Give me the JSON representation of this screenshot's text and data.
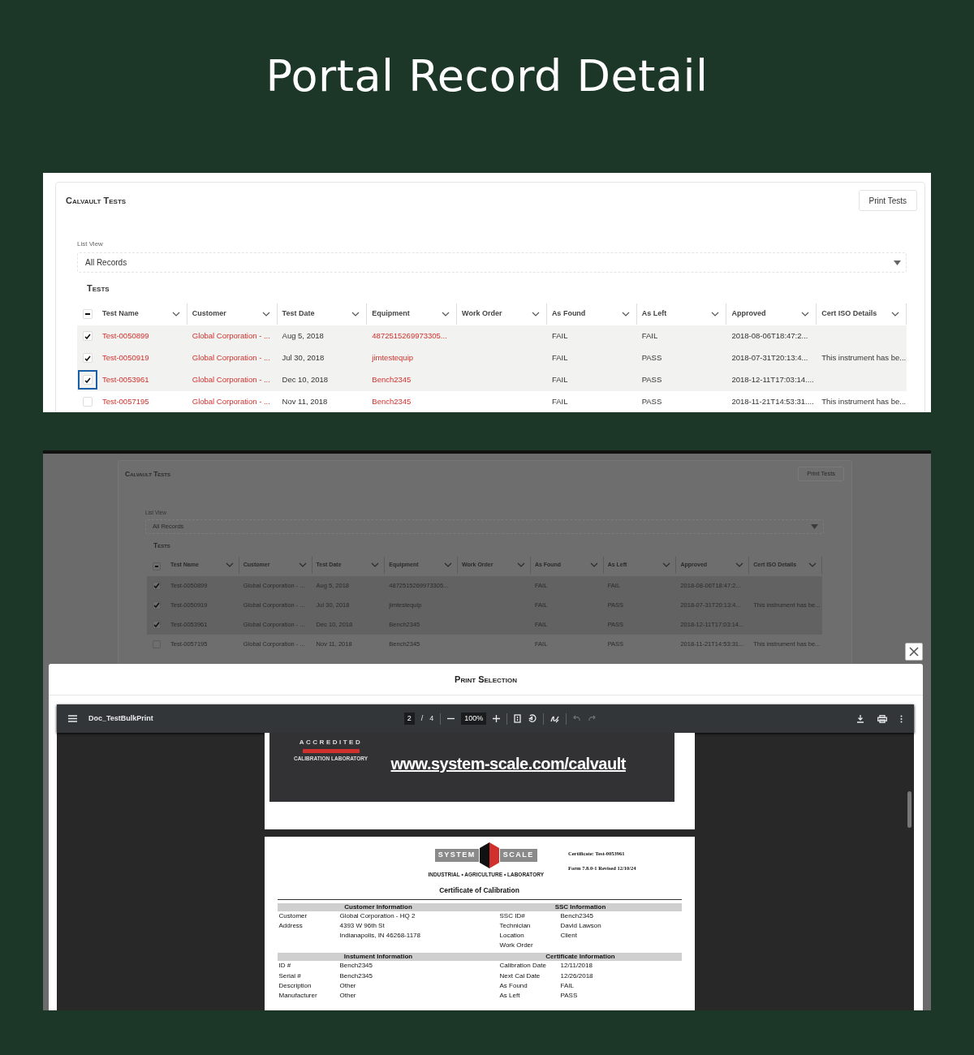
{
  "heading": "Portal Record Detail",
  "list_screen": {
    "card": {
      "title": "Calvault Tests",
      "print_button": "Print Tests",
      "list_view_label": "List View",
      "list_view_value": "All Records",
      "section_title": "Tests",
      "select_all_partial": true,
      "columns": [
        {
          "label": "Test Name"
        },
        {
          "label": "Customer"
        },
        {
          "label": "Test Date"
        },
        {
          "label": "Equipment"
        },
        {
          "label": "Work Order"
        },
        {
          "label": "As Found"
        },
        {
          "label": "As Left"
        },
        {
          "label": "Approved"
        },
        {
          "label": "Cert ISO Details"
        }
      ],
      "rows": [
        {
          "selected": true,
          "focused": false,
          "test_name": "Test-0050899",
          "customer": "Global Corporation - ...",
          "test_date": "Aug 5, 2018",
          "equipment": "4872515269973305...",
          "as_found": "FAIL",
          "as_left": "FAIL",
          "approved": "2018-08-06T18:47:2..."
        },
        {
          "selected": true,
          "focused": false,
          "test_name": "Test-0050919",
          "customer": "Global Corporation - ...",
          "test_date": "Jul 30, 2018",
          "equipment": "jimtestequip",
          "as_found": "FAIL",
          "as_left": "PASS",
          "approved": "2018-07-31T20:13:4...",
          "cert_iso_details": "This instrument has be..."
        },
        {
          "selected": true,
          "focused": true,
          "test_name": "Test-0053961",
          "customer": "Global Corporation - ...",
          "test_date": "Dec 10, 2018",
          "equipment": "Bench2345",
          "as_found": "FAIL",
          "as_left": "PASS",
          "approved": "2018-12-11T17:03:14...."
        },
        {
          "selected": false,
          "focused": false,
          "test_name": "Test-0057195",
          "customer": "Global Corporation - ...",
          "test_date": "Nov 11, 2018",
          "equipment": "Bench2345",
          "as_found": "FAIL",
          "as_left": "PASS",
          "approved": "2018-11-21T14:53:31....",
          "cert_iso_details": "This instrument has be..."
        }
      ]
    }
  },
  "print_screen": {
    "card": {
      "title": "Calvault Tests",
      "print_button": "Print Tests",
      "list_view_label": "List View",
      "list_view_value": "All Records",
      "section_title": "Tests",
      "select_all_partial": true,
      "columns": [
        {
          "label": "Test Name"
        },
        {
          "label": "Customer"
        },
        {
          "label": "Test Date"
        },
        {
          "label": "Equipment"
        },
        {
          "label": "Work Order"
        },
        {
          "label": "As Found"
        },
        {
          "label": "As Left"
        },
        {
          "label": "Approved"
        },
        {
          "label": "Cert ISO Details"
        }
      ],
      "rows": [
        {
          "selected": true,
          "test_name": "Test-0050899",
          "customer": "Global Corporation - ...",
          "test_date": "Aug 5, 2018",
          "equipment": "4872515269973305...",
          "as_found": "FAIL",
          "as_left": "FAIL",
          "approved": "2018-08-06T18:47:2..."
        },
        {
          "selected": true,
          "test_name": "Test-0050919",
          "customer": "Global Corporation - ...",
          "test_date": "Jul 30, 2018",
          "equipment": "jimtestequip",
          "as_found": "FAIL",
          "as_left": "PASS",
          "approved": "2018-07-31T20:13:4...",
          "cert_iso_details": "This instrument has be..."
        },
        {
          "selected": true,
          "test_name": "Test-0053961",
          "customer": "Global Corporation - ...",
          "test_date": "Dec 10, 2018",
          "equipment": "Bench2345",
          "as_found": "FAIL",
          "as_left": "PASS",
          "approved": "2018-12-11T17:03:14..."
        },
        {
          "selected": false,
          "test_name": "Test-0057195",
          "customer": "Global Corporation - ...",
          "test_date": "Nov 11, 2018",
          "equipment": "Bench2345",
          "as_found": "FAIL",
          "as_left": "PASS",
          "approved": "2018-11-21T14:53:31...",
          "cert_iso_details": "This instrument has be..."
        }
      ]
    },
    "modal": {
      "title": "Print Selection",
      "viewer": {
        "file_name": "Doc_TestBulkPrint",
        "page_current": "2",
        "page_separator": "/",
        "page_total": "4",
        "zoom": "100%",
        "undo": {
          "disabled": true
        },
        "redo": {
          "disabled": true
        }
      },
      "previous_page": {
        "badge_word": "ACCREDITED",
        "badge_caption": "CALIBRATION LABORATORY",
        "link": "www.system-scale.com/calvault"
      },
      "certificate": {
        "logo_left": "SYSTEM",
        "logo_right": "SCALE",
        "logo_tagline": "INDUSTRIAL • AGRICULTURE • LABORATORY",
        "certificate_line": "Certificate: Test-0053961",
        "form_line": "Form 7.8.0-1 Revised 12/10/24",
        "title": "Certificate of Calibration",
        "sections": [
          {
            "left_title": "Customer Information",
            "right_title": "SSC Information",
            "left_rows": [
              {
                "label": "Customer",
                "value": "Global Corporation - HQ 2"
              },
              {
                "label": "Address",
                "value": "4393 W 96th St"
              },
              {
                "value": "Indianapolis, IN 46268-1178"
              }
            ],
            "right_rows": [
              {
                "label": "SSC ID#",
                "value": "Bench2345"
              },
              {
                "label": "Technician",
                "value": "David Lawson"
              },
              {
                "label": "Location",
                "value": "Client"
              },
              {
                "label": "Work Order"
              }
            ]
          },
          {
            "left_title": "Instument Information",
            "right_title": "Certificate Information",
            "left_rows": [
              {
                "label": "ID #",
                "value": "Bench2345"
              },
              {
                "label": "Serial #",
                "value": "Bench2345"
              },
              {
                "label": "Description",
                "value": "Other"
              },
              {
                "label": "Manufacturer",
                "value": "Other"
              }
            ],
            "right_rows": [
              {
                "label": "Calibration Date",
                "value": "12/11/2018"
              },
              {
                "label": "Next Cal Date",
                "value": "12/26/2018"
              },
              {
                "label": "As Found",
                "value": "FAIL"
              },
              {
                "label": "As Left",
                "value": "PASS"
              }
            ]
          }
        ]
      }
    }
  }
}
